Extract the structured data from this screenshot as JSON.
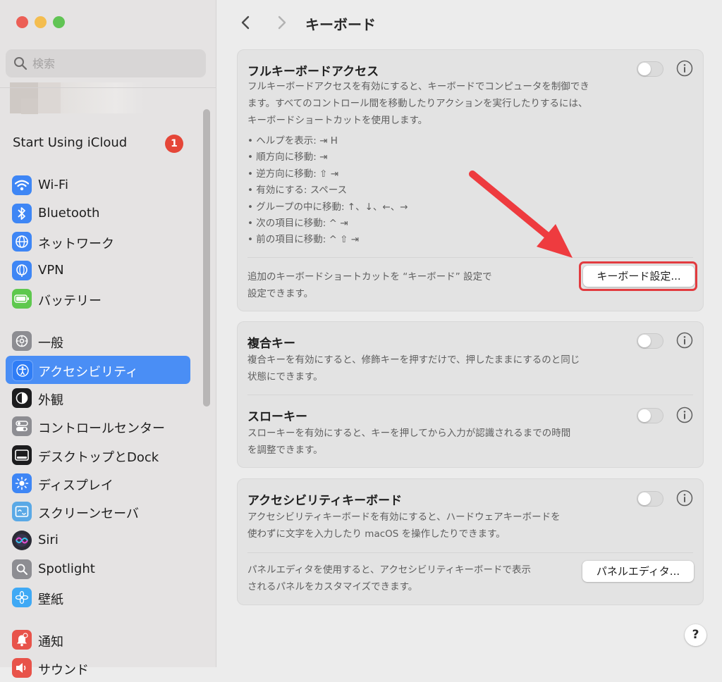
{
  "window": {
    "traffic_lights": [
      {
        "name": "close-button",
        "color": "#ec5f56"
      },
      {
        "name": "minimize-button",
        "color": "#f4bd4f"
      },
      {
        "name": "zoom-button",
        "color": "#61c454"
      }
    ]
  },
  "sidebar": {
    "search_placeholder": "検索",
    "icloud_label": "Start Using iCloud",
    "icloud_badge": "1",
    "items": [
      {
        "id": "wifi",
        "label": "Wi-Fi",
        "icon": "wifi-icon",
        "color": "#3e86f5"
      },
      {
        "id": "bluetooth",
        "label": "Bluetooth",
        "icon": "bluetooth-icon",
        "color": "#3e86f5"
      },
      {
        "id": "network",
        "label": "ネットワーク",
        "icon": "globe-icon",
        "color": "#3e86f5"
      },
      {
        "id": "vpn",
        "label": "VPN",
        "icon": "vpn-globe-icon",
        "color": "#3e86f5"
      },
      {
        "id": "battery",
        "label": "バッテリー",
        "icon": "battery-icon",
        "color": "#5ec84e"
      },
      {
        "id": "general",
        "label": "一般",
        "icon": "gear-icon",
        "color": "#8d8d92"
      },
      {
        "id": "accessibility",
        "label": "アクセシビリティ",
        "icon": "accessibility-icon",
        "color": "#2f7df6",
        "selected": true
      },
      {
        "id": "appearance",
        "label": "外観",
        "icon": "appearance-icon",
        "color": "#1c1c1e"
      },
      {
        "id": "control-center",
        "label": "コントロールセンター",
        "icon": "control-center-icon",
        "color": "#8d8d92"
      },
      {
        "id": "desktop-dock",
        "label": "デスクトップとDock",
        "icon": "dock-icon",
        "color": "#1c1c1e"
      },
      {
        "id": "displays",
        "label": "ディスプレイ",
        "icon": "sun-icon",
        "color": "#3e86f5"
      },
      {
        "id": "screensaver",
        "label": "スクリーンセーバ",
        "icon": "screensaver-icon",
        "color": "#5aa9e6"
      },
      {
        "id": "siri",
        "label": "Siri",
        "icon": "siri-icon",
        "color": "#2b2b36"
      },
      {
        "id": "spotlight",
        "label": "Spotlight",
        "icon": "spotlight-icon",
        "color": "#8d8d92"
      },
      {
        "id": "wallpaper",
        "label": "壁紙",
        "icon": "wallpaper-flower-icon",
        "color": "#3fa9f5"
      },
      {
        "id": "notifications",
        "label": "通知",
        "icon": "bell-icon",
        "color": "#e8534a"
      },
      {
        "id": "sound",
        "label": "サウンド",
        "icon": "speaker-icon",
        "color": "#e8534a"
      }
    ]
  },
  "main": {
    "title": "キーボード",
    "full_keyboard_access": {
      "title": "フルキーボードアクセス",
      "description_lines": [
        "フルキーボードアクセスを有効にすると、キーボードでコンピュータを制御でき",
        "ます。すべてのコントロール間を移動したりアクションを実行したりするには、",
        "キーボードショートカットを使用します。"
      ],
      "shortcuts": [
        "ヘルプを表示: ⇥ H",
        "順方向に移動: ⇥",
        "逆方向に移動: ⇧ ⇥",
        "有効にする: スペース",
        "グループの中に移動: ↑、↓、←、→",
        "次の項目に移動: ^ ⇥",
        "前の項目に移動: ^ ⇧ ⇥"
      ],
      "footer_lines": [
        "追加のキーボードショートカットを “キーボード” 設定で",
        "設定できます。"
      ],
      "button_label": "キーボード設定...",
      "toggle_on": false
    },
    "sticky_keys": {
      "title": "複合キー",
      "description_lines": [
        "複合キーを有効にすると、修飾キーを押すだけで、押したままにするのと同じ",
        "状態にできます。"
      ],
      "toggle_on": false
    },
    "slow_keys": {
      "title": "スローキー",
      "description_lines": [
        "スローキーを有効にすると、キーを押してから入力が認識されるまでの時間",
        "を調整できます。"
      ],
      "toggle_on": false
    },
    "accessibility_keyboard": {
      "title": "アクセシビリティキーボード",
      "description_lines": [
        "アクセシビリティキーボードを有効にすると、ハードウェアキーボードを",
        "使わずに文字を入力したり macOS を操作したりできます。"
      ],
      "footer_lines": [
        "パネルエディタを使用すると、アクセシビリティキーボードで表示",
        "されるパネルをカスタマイズできます。"
      ],
      "button_label": "パネルエディタ...",
      "toggle_on": false
    },
    "help_label": "?"
  },
  "annotation": {
    "highlight_color": "#e23b3f",
    "arrow_color": "#ee3b3f"
  }
}
